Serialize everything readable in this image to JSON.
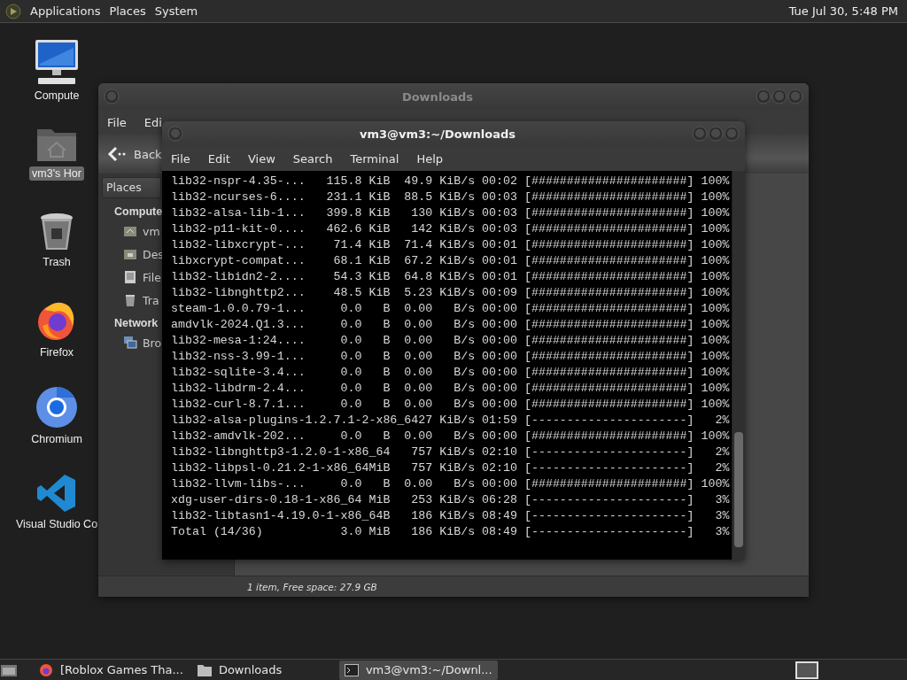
{
  "top_panel": {
    "menus": [
      "Applications",
      "Places",
      "System"
    ],
    "clock": "Tue Jul 30, 5:48 PM"
  },
  "desktop_icons": [
    {
      "label": "Compute",
      "kind": "computer",
      "selected": false
    },
    {
      "label": "vm3's Hor",
      "kind": "home",
      "selected": true
    },
    {
      "label": "Trash",
      "kind": "trash",
      "selected": false
    },
    {
      "label": "Firefox",
      "kind": "firefox",
      "selected": false
    },
    {
      "label": "Chromium",
      "kind": "chromium",
      "selected": false
    },
    {
      "label": "Visual Studio Co",
      "kind": "vscode",
      "selected": false
    }
  ],
  "file_manager": {
    "title": "Downloads",
    "menus": [
      "File",
      "Edi"
    ],
    "back_label": "Back",
    "places_label": "Places",
    "sidebar": [
      {
        "heading": "Compute",
        "items": [
          {
            "label": "vm",
            "kind": "home"
          },
          {
            "label": "Des",
            "kind": "desktop"
          },
          {
            "label": "File",
            "kind": "drive"
          },
          {
            "label": "Tra",
            "kind": "trash"
          }
        ]
      },
      {
        "heading": "Network",
        "items": [
          {
            "label": "Bro",
            "kind": "network"
          }
        ]
      }
    ],
    "status": "1 item, Free space: 27.9 GB"
  },
  "terminal": {
    "title": "vm3@vm3:~/Downloads",
    "menus": [
      "File",
      "Edit",
      "View",
      "Search",
      "Terminal",
      "Help"
    ],
    "lines": [
      "lib32-nspr-4.35-...   115.8 KiB  49.9 KiB/s 00:02 [######################] 100%",
      "lib32-ncurses-6....   231.1 KiB  88.5 KiB/s 00:03 [######################] 100%",
      "lib32-alsa-lib-1...   399.8 KiB   130 KiB/s 00:03 [######################] 100%",
      "lib32-p11-kit-0....   462.6 KiB   142 KiB/s 00:03 [######################] 100%",
      "lib32-libxcrypt-...    71.4 KiB  71.4 KiB/s 00:01 [######################] 100%",
      "libxcrypt-compat...    68.1 KiB  67.2 KiB/s 00:01 [######################] 100%",
      "lib32-libidn2-2....    54.3 KiB  64.8 KiB/s 00:01 [######################] 100%",
      "lib32-libnghttp2...    48.5 KiB  5.23 KiB/s 00:09 [######################] 100%",
      "steam-1.0.0.79-1...     0.0   B  0.00   B/s 00:00 [######################] 100%",
      "amdvlk-2024.Q1.3...     0.0   B  0.00   B/s 00:00 [######################] 100%",
      "lib32-mesa-1:24....     0.0   B  0.00   B/s 00:00 [######################] 100%",
      "lib32-nss-3.99-1...     0.0   B  0.00   B/s 00:00 [######################] 100%",
      "lib32-sqlite-3.4...     0.0   B  0.00   B/s 00:00 [######################] 100%",
      "lib32-libdrm-2.4...     0.0   B  0.00   B/s 00:00 [######################] 100%",
      "lib32-curl-8.7.1...     0.0   B  0.00   B/s 00:00 [######################] 100%",
      "lib32-alsa-plugins-1.2.7.1-2-x86_6427 KiB/s 01:59 [----------------------]   2%",
      "lib32-amdvlk-202...     0.0   B  0.00   B/s 00:00 [######################] 100%",
      "lib32-libnghttp3-1.2.0-1-x86_64   757 KiB/s 02:10 [----------------------]   2%",
      "lib32-libpsl-0.21.2-1-x86_64MiB   757 KiB/s 02:10 [----------------------]   2%",
      "lib32-llvm-libs-...     0.0   B  0.00   B/s 00:00 [######################] 100%",
      "xdg-user-dirs-0.18-1-x86_64 MiB   253 KiB/s 06:28 [----------------------]   3%",
      "lib32-libtasn1-4.19.0-1-x86_64B   186 KiB/s 08:49 [----------------------]   3%",
      "Total (14/36)           3.0 MiB   186 KiB/s 08:49 [----------------------]   3%"
    ]
  },
  "taskbar": {
    "items": [
      {
        "label": "[Roblox Games Tha...",
        "kind": "browser",
        "selected": false
      },
      {
        "label": "Downloads",
        "kind": "folder",
        "selected": false
      },
      {
        "label": "vm3@vm3:~/Downl...",
        "kind": "terminal",
        "selected": true
      }
    ]
  }
}
